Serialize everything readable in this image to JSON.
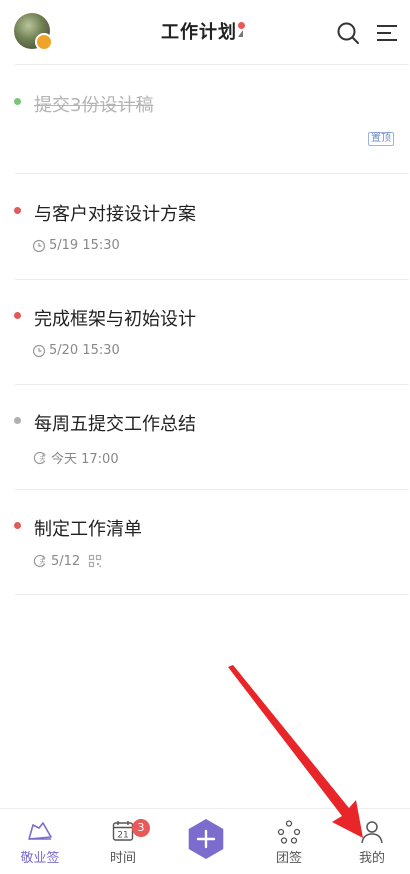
{
  "header": {
    "title": "工作计划",
    "accent": "#e85a5a"
  },
  "tasks": [
    {
      "title": "提交3份设计稿",
      "done": true,
      "dot_color": "#7cc47a",
      "badge": "置顶"
    },
    {
      "title": "与客户对接设计方案",
      "done": false,
      "dot_color": "#e05a5a",
      "meta": "5/19 15:30",
      "meta_icon": "clock-icon"
    },
    {
      "title": "完成框架与初始设计",
      "done": false,
      "dot_color": "#e05a5a",
      "meta": "5/20 15:30",
      "meta_icon": "clock-icon"
    },
    {
      "title": "每周五提交工作总结",
      "done": false,
      "dot_color": "#b0b0b0",
      "meta": "今天 17:00",
      "meta_icon": "repeat-clock-icon"
    },
    {
      "title": "制定工作清单",
      "done": false,
      "dot_color": "#e05a5a",
      "meta": "5/12",
      "meta_icon": "repeat-clock-icon"
    }
  ],
  "repeat_icon_label": "天",
  "bottom_nav": {
    "items": [
      {
        "label": "敬业签",
        "icon": "notes-icon",
        "active": true
      },
      {
        "label": "时间",
        "icon": "calendar-icon",
        "active": false,
        "calendar_day": "21",
        "badge": "3"
      },
      {
        "label": "团签",
        "icon": "team-icon",
        "active": false
      },
      {
        "label": "我的",
        "icon": "profile-icon",
        "active": false
      }
    ],
    "add_icon": "plus-icon",
    "accent": "#7c6cce"
  }
}
